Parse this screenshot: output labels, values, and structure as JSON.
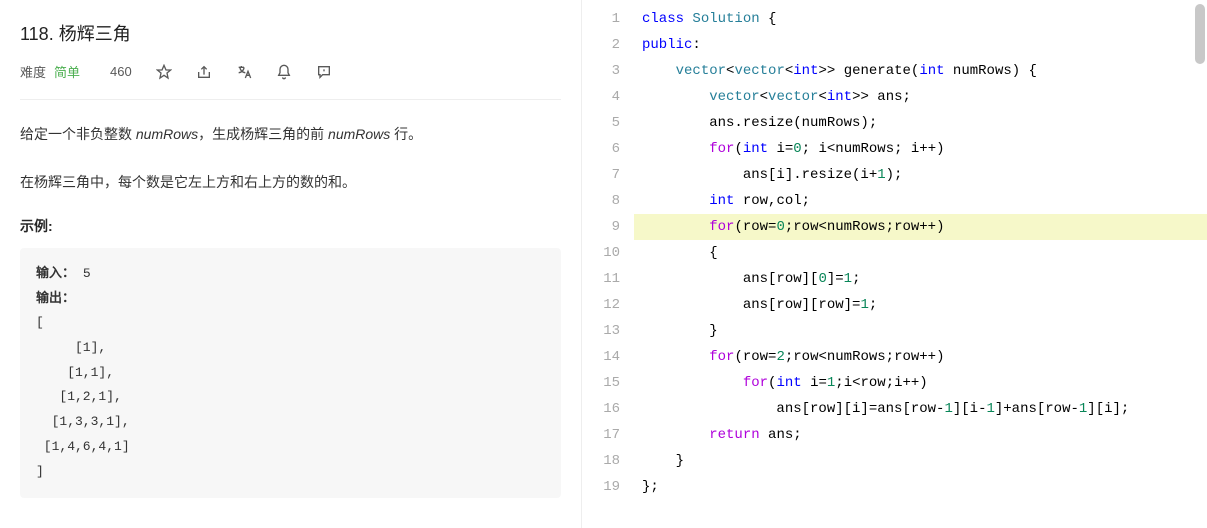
{
  "problem": {
    "title": "118. 杨辉三角",
    "difficulty_label": "难度",
    "difficulty_value": "简单",
    "likes": "460",
    "description_parts": [
      "给定一个非负整数 ",
      "numRows",
      "，生成杨辉三角的前 ",
      "numRows",
      " 行。"
    ],
    "desc2": "在杨辉三角中，每个数是它左上方和右上方的数的和。",
    "example_label": "示例:",
    "input_label": "输入：",
    "input_value": " 5",
    "output_label": "输出：",
    "output_lines": [
      "[",
      "     [1],",
      "    [1,1],",
      "   [1,2,1],",
      "  [1,3,3,1],",
      " [1,4,6,4,1]",
      "]"
    ]
  },
  "icons": {
    "thumbs_up": "thumbs-up-icon",
    "star": "star-icon",
    "share": "share-icon",
    "translate": "translate-icon",
    "bell": "bell-icon",
    "feedback": "feedback-icon"
  },
  "code": {
    "lines": [
      {
        "n": 1,
        "tokens": [
          {
            "t": "class ",
            "c": "kw"
          },
          {
            "t": "Solution",
            "c": "type"
          },
          {
            "t": " {",
            "c": "op"
          }
        ]
      },
      {
        "n": 2,
        "tokens": [
          {
            "t": "public",
            "c": "kw"
          },
          {
            "t": ":",
            "c": "op"
          }
        ]
      },
      {
        "n": 3,
        "tokens": [
          {
            "t": "    ",
            "c": "id"
          },
          {
            "t": "vector",
            "c": "type"
          },
          {
            "t": "<",
            "c": "op"
          },
          {
            "t": "vector",
            "c": "type"
          },
          {
            "t": "<",
            "c": "op"
          },
          {
            "t": "int",
            "c": "kw"
          },
          {
            "t": ">> generate(",
            "c": "op"
          },
          {
            "t": "int",
            "c": "kw"
          },
          {
            "t": " numRows) {",
            "c": "op"
          }
        ]
      },
      {
        "n": 4,
        "tokens": [
          {
            "t": "        ",
            "c": "id"
          },
          {
            "t": "vector",
            "c": "type"
          },
          {
            "t": "<",
            "c": "op"
          },
          {
            "t": "vector",
            "c": "type"
          },
          {
            "t": "<",
            "c": "op"
          },
          {
            "t": "int",
            "c": "kw"
          },
          {
            "t": ">> ans;",
            "c": "op"
          }
        ]
      },
      {
        "n": 5,
        "tokens": [
          {
            "t": "        ans.resize(numRows);",
            "c": "id"
          }
        ]
      },
      {
        "n": 6,
        "tokens": [
          {
            "t": "        ",
            "c": "id"
          },
          {
            "t": "for",
            "c": "ctrl"
          },
          {
            "t": "(",
            "c": "op"
          },
          {
            "t": "int",
            "c": "kw"
          },
          {
            "t": " i=",
            "c": "op"
          },
          {
            "t": "0",
            "c": "num"
          },
          {
            "t": "; i<numRows; i++)",
            "c": "op"
          }
        ]
      },
      {
        "n": 7,
        "tokens": [
          {
            "t": "            ans[i].resize(i+",
            "c": "id"
          },
          {
            "t": "1",
            "c": "num"
          },
          {
            "t": ");",
            "c": "op"
          }
        ]
      },
      {
        "n": 8,
        "tokens": [
          {
            "t": "        ",
            "c": "id"
          },
          {
            "t": "int",
            "c": "kw"
          },
          {
            "t": " row,col;",
            "c": "op"
          }
        ]
      },
      {
        "n": 9,
        "hl": true,
        "tokens": [
          {
            "t": "        ",
            "c": "id"
          },
          {
            "t": "for",
            "c": "ctrl"
          },
          {
            "t": "(row=",
            "c": "op"
          },
          {
            "t": "0",
            "c": "num"
          },
          {
            "t": ";row<numRows;row++)",
            "c": "op"
          }
        ]
      },
      {
        "n": 10,
        "tokens": [
          {
            "t": "        {",
            "c": "op"
          }
        ]
      },
      {
        "n": 11,
        "tokens": [
          {
            "t": "            ans[row][",
            "c": "id"
          },
          {
            "t": "0",
            "c": "num"
          },
          {
            "t": "]=",
            "c": "op"
          },
          {
            "t": "1",
            "c": "num"
          },
          {
            "t": ";",
            "c": "op"
          }
        ]
      },
      {
        "n": 12,
        "tokens": [
          {
            "t": "            ans[row][row]=",
            "c": "id"
          },
          {
            "t": "1",
            "c": "num"
          },
          {
            "t": ";",
            "c": "op"
          }
        ]
      },
      {
        "n": 13,
        "tokens": [
          {
            "t": "        }",
            "c": "op"
          }
        ]
      },
      {
        "n": 14,
        "tokens": [
          {
            "t": "        ",
            "c": "id"
          },
          {
            "t": "for",
            "c": "ctrl"
          },
          {
            "t": "(row=",
            "c": "op"
          },
          {
            "t": "2",
            "c": "num"
          },
          {
            "t": ";row<numRows;row++)",
            "c": "op"
          }
        ]
      },
      {
        "n": 15,
        "tokens": [
          {
            "t": "            ",
            "c": "id"
          },
          {
            "t": "for",
            "c": "ctrl"
          },
          {
            "t": "(",
            "c": "op"
          },
          {
            "t": "int",
            "c": "kw"
          },
          {
            "t": " i=",
            "c": "op"
          },
          {
            "t": "1",
            "c": "num"
          },
          {
            "t": ";i<row;i++)",
            "c": "op"
          }
        ]
      },
      {
        "n": 16,
        "tokens": [
          {
            "t": "                ans[row][i]=ans[row-",
            "c": "id"
          },
          {
            "t": "1",
            "c": "num"
          },
          {
            "t": "][i-",
            "c": "id"
          },
          {
            "t": "1",
            "c": "num"
          },
          {
            "t": "]+ans[row-",
            "c": "id"
          },
          {
            "t": "1",
            "c": "num"
          },
          {
            "t": "][i];",
            "c": "op"
          }
        ]
      },
      {
        "n": 17,
        "tokens": [
          {
            "t": "        ",
            "c": "id"
          },
          {
            "t": "return",
            "c": "ctrl"
          },
          {
            "t": " ans;",
            "c": "op"
          }
        ]
      },
      {
        "n": 18,
        "tokens": [
          {
            "t": "    }",
            "c": "op"
          }
        ]
      },
      {
        "n": 19,
        "tokens": [
          {
            "t": "};",
            "c": "op"
          }
        ]
      }
    ]
  }
}
